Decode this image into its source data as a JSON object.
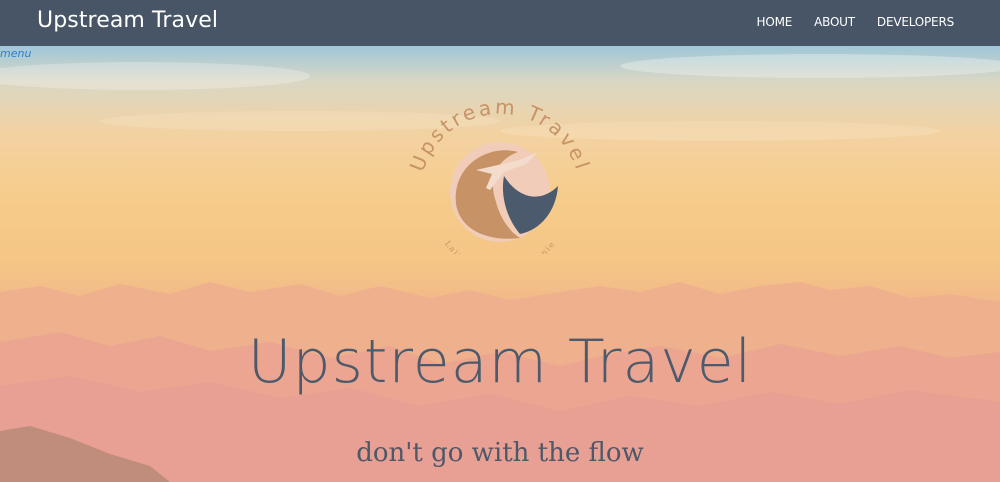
{
  "navbar": {
    "brand": "Upstream Travel",
    "links": [
      "HOME",
      "ABOUT",
      "DEVELOPERS"
    ]
  },
  "menu_label": "menu",
  "logo": {
    "arc_text": "Upstream Travel",
    "names_text": "Lainey Elena Stephanie"
  },
  "hero": {
    "title": "Upstream Travel",
    "tagline": "don't go with the flow"
  },
  "colors": {
    "navbar": "#475567",
    "title_text": "#4d5a6b",
    "menu_link": "#2f7ed8",
    "logo_tan": "#c79366",
    "logo_navy": "#4b5a6d"
  }
}
